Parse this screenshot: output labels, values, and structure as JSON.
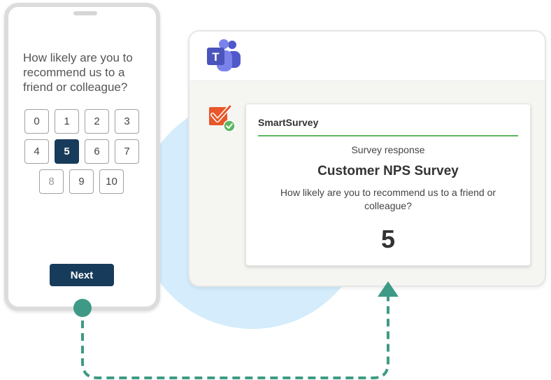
{
  "phone": {
    "question": "How likely are you to recommend us to a friend or colleague?",
    "scores": [
      "0",
      "1",
      "2",
      "3",
      "4",
      "5",
      "6",
      "7",
      "8",
      "9",
      "10"
    ],
    "selected": "5",
    "next_label": "Next"
  },
  "teams": {
    "logo_letter": "T",
    "card": {
      "brand": "SmartSurvey",
      "subtitle": "Survey response",
      "title": "Customer NPS Survey",
      "question": "How likely are you to recommend us to a friend or colleague?",
      "answer": "5"
    }
  },
  "colors": {
    "navy": "#173b5a",
    "teal": "#3e9a85",
    "green_line": "#5db75f",
    "circle": "#d4ecfb",
    "smartsurvey_orange": "#e8582a"
  },
  "icons": {
    "teams_logo": "microsoft-teams-icon",
    "smartsurvey_logo": "smartsurvey-check-icon"
  }
}
